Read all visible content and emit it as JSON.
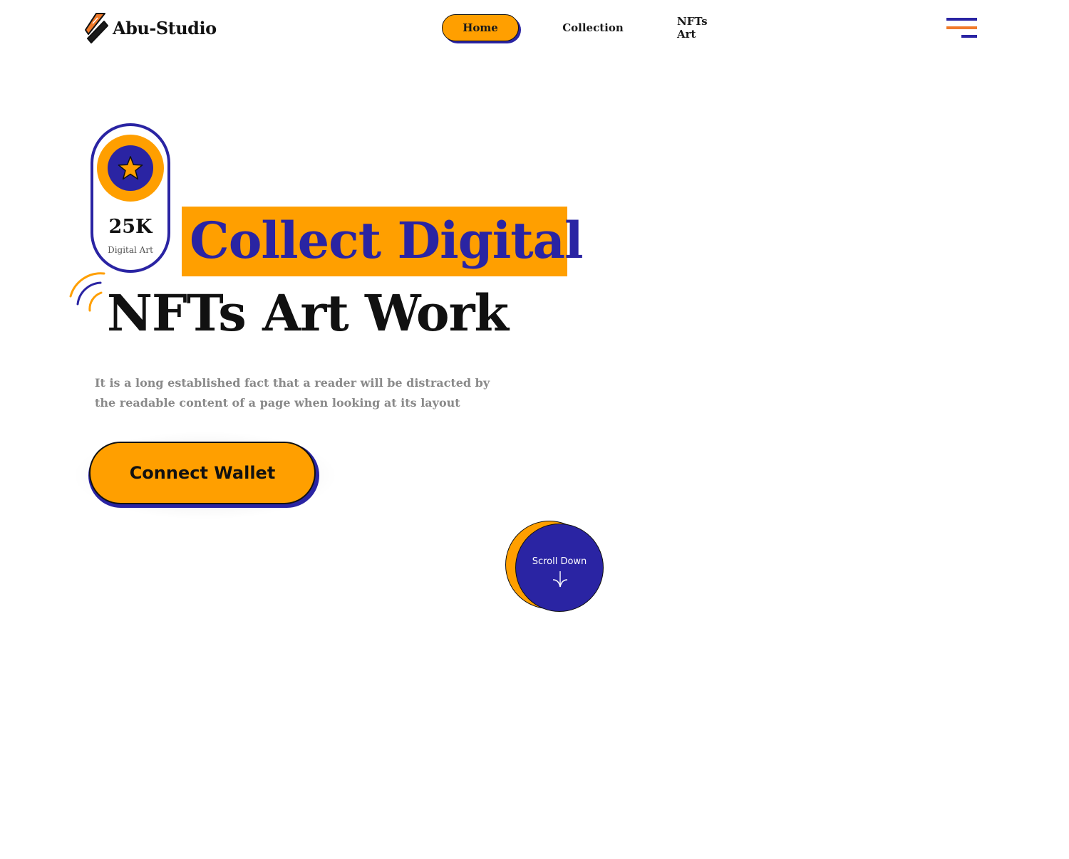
{
  "header": {
    "brand": "Abu-Studio",
    "nav": [
      {
        "label": "Home",
        "active": true
      },
      {
        "label": "Collection",
        "active": false
      },
      {
        "label": "NFTs Art",
        "active": false
      }
    ],
    "menu_icon": "hamburger-menu-icon"
  },
  "badge": {
    "value": "25K",
    "label": "Digital Art",
    "icon": "star-icon"
  },
  "hero": {
    "highlight": "Collect Digital",
    "title": "NFTs  Art Work",
    "description": "It is a long established fact that a reader will be distracted by the readable content of a page when looking at its layout",
    "cta_label": "Connect Wallet"
  },
  "scroll": {
    "label": "Scroll Down",
    "icon": "arrow-down-icon"
  },
  "colors": {
    "accent_orange": "#ff9f00",
    "accent_blue": "#2a24a3",
    "menu_orange": "#f07a2a",
    "text_dark": "#111111",
    "text_muted": "#8a8a8a"
  }
}
